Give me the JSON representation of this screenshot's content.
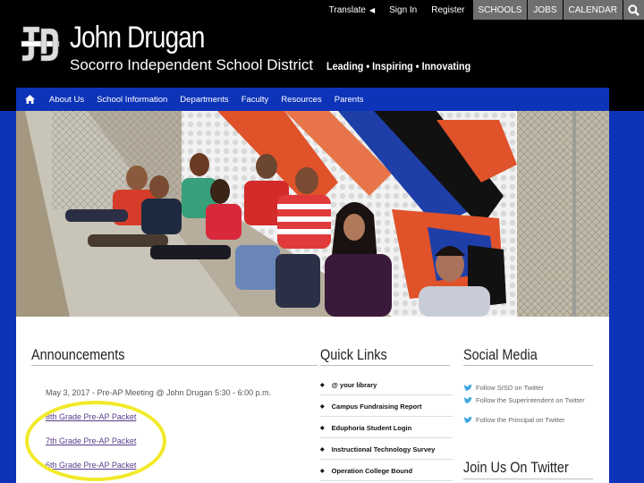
{
  "utility_bar": {
    "translate": "Translate",
    "sign_in": "Sign In",
    "register": "Register",
    "buttons": [
      "SCHOOLS",
      "JOBS",
      "CALENDAR"
    ]
  },
  "header": {
    "logo_text": "JD",
    "school_name": "John Drugan",
    "district_name": "Socorro Independent School District",
    "tagline": "Leading • Inspiring • Innovating"
  },
  "nav": {
    "items": [
      "About Us",
      "School Information",
      "Departments",
      "Faculty",
      "Resources",
      "Parents"
    ]
  },
  "announcements": {
    "title": "Announcements",
    "date_line": "May 3, 2017 - Pre-AP Meeting @ John Drugan 5:30 - 6:00 p.m.",
    "links": [
      "8th Grade Pre-AP Packet",
      "7th Grade Pre-AP Packet",
      "6th Grade Pre-AP Packet"
    ]
  },
  "quick_links": {
    "title": "Quick Links",
    "items": [
      "@ your library",
      "Campus Fundraising Report",
      "Eduphoria Student Login",
      "Instructional Technology Survey",
      "Operation College Bound"
    ]
  },
  "social_media": {
    "title": "Social Media",
    "items": [
      "Follow SISD on Twitter",
      "Follow the Superintendent on Twitter",
      "Follow the Principal on Twitter"
    ]
  },
  "twitter": {
    "title": "Join Us On Twitter"
  },
  "colors": {
    "brand_blue": "#0d33b8",
    "header_black": "#000000",
    "highlight": "#f2ea2a",
    "twitter_blue": "#3ea6e0"
  }
}
